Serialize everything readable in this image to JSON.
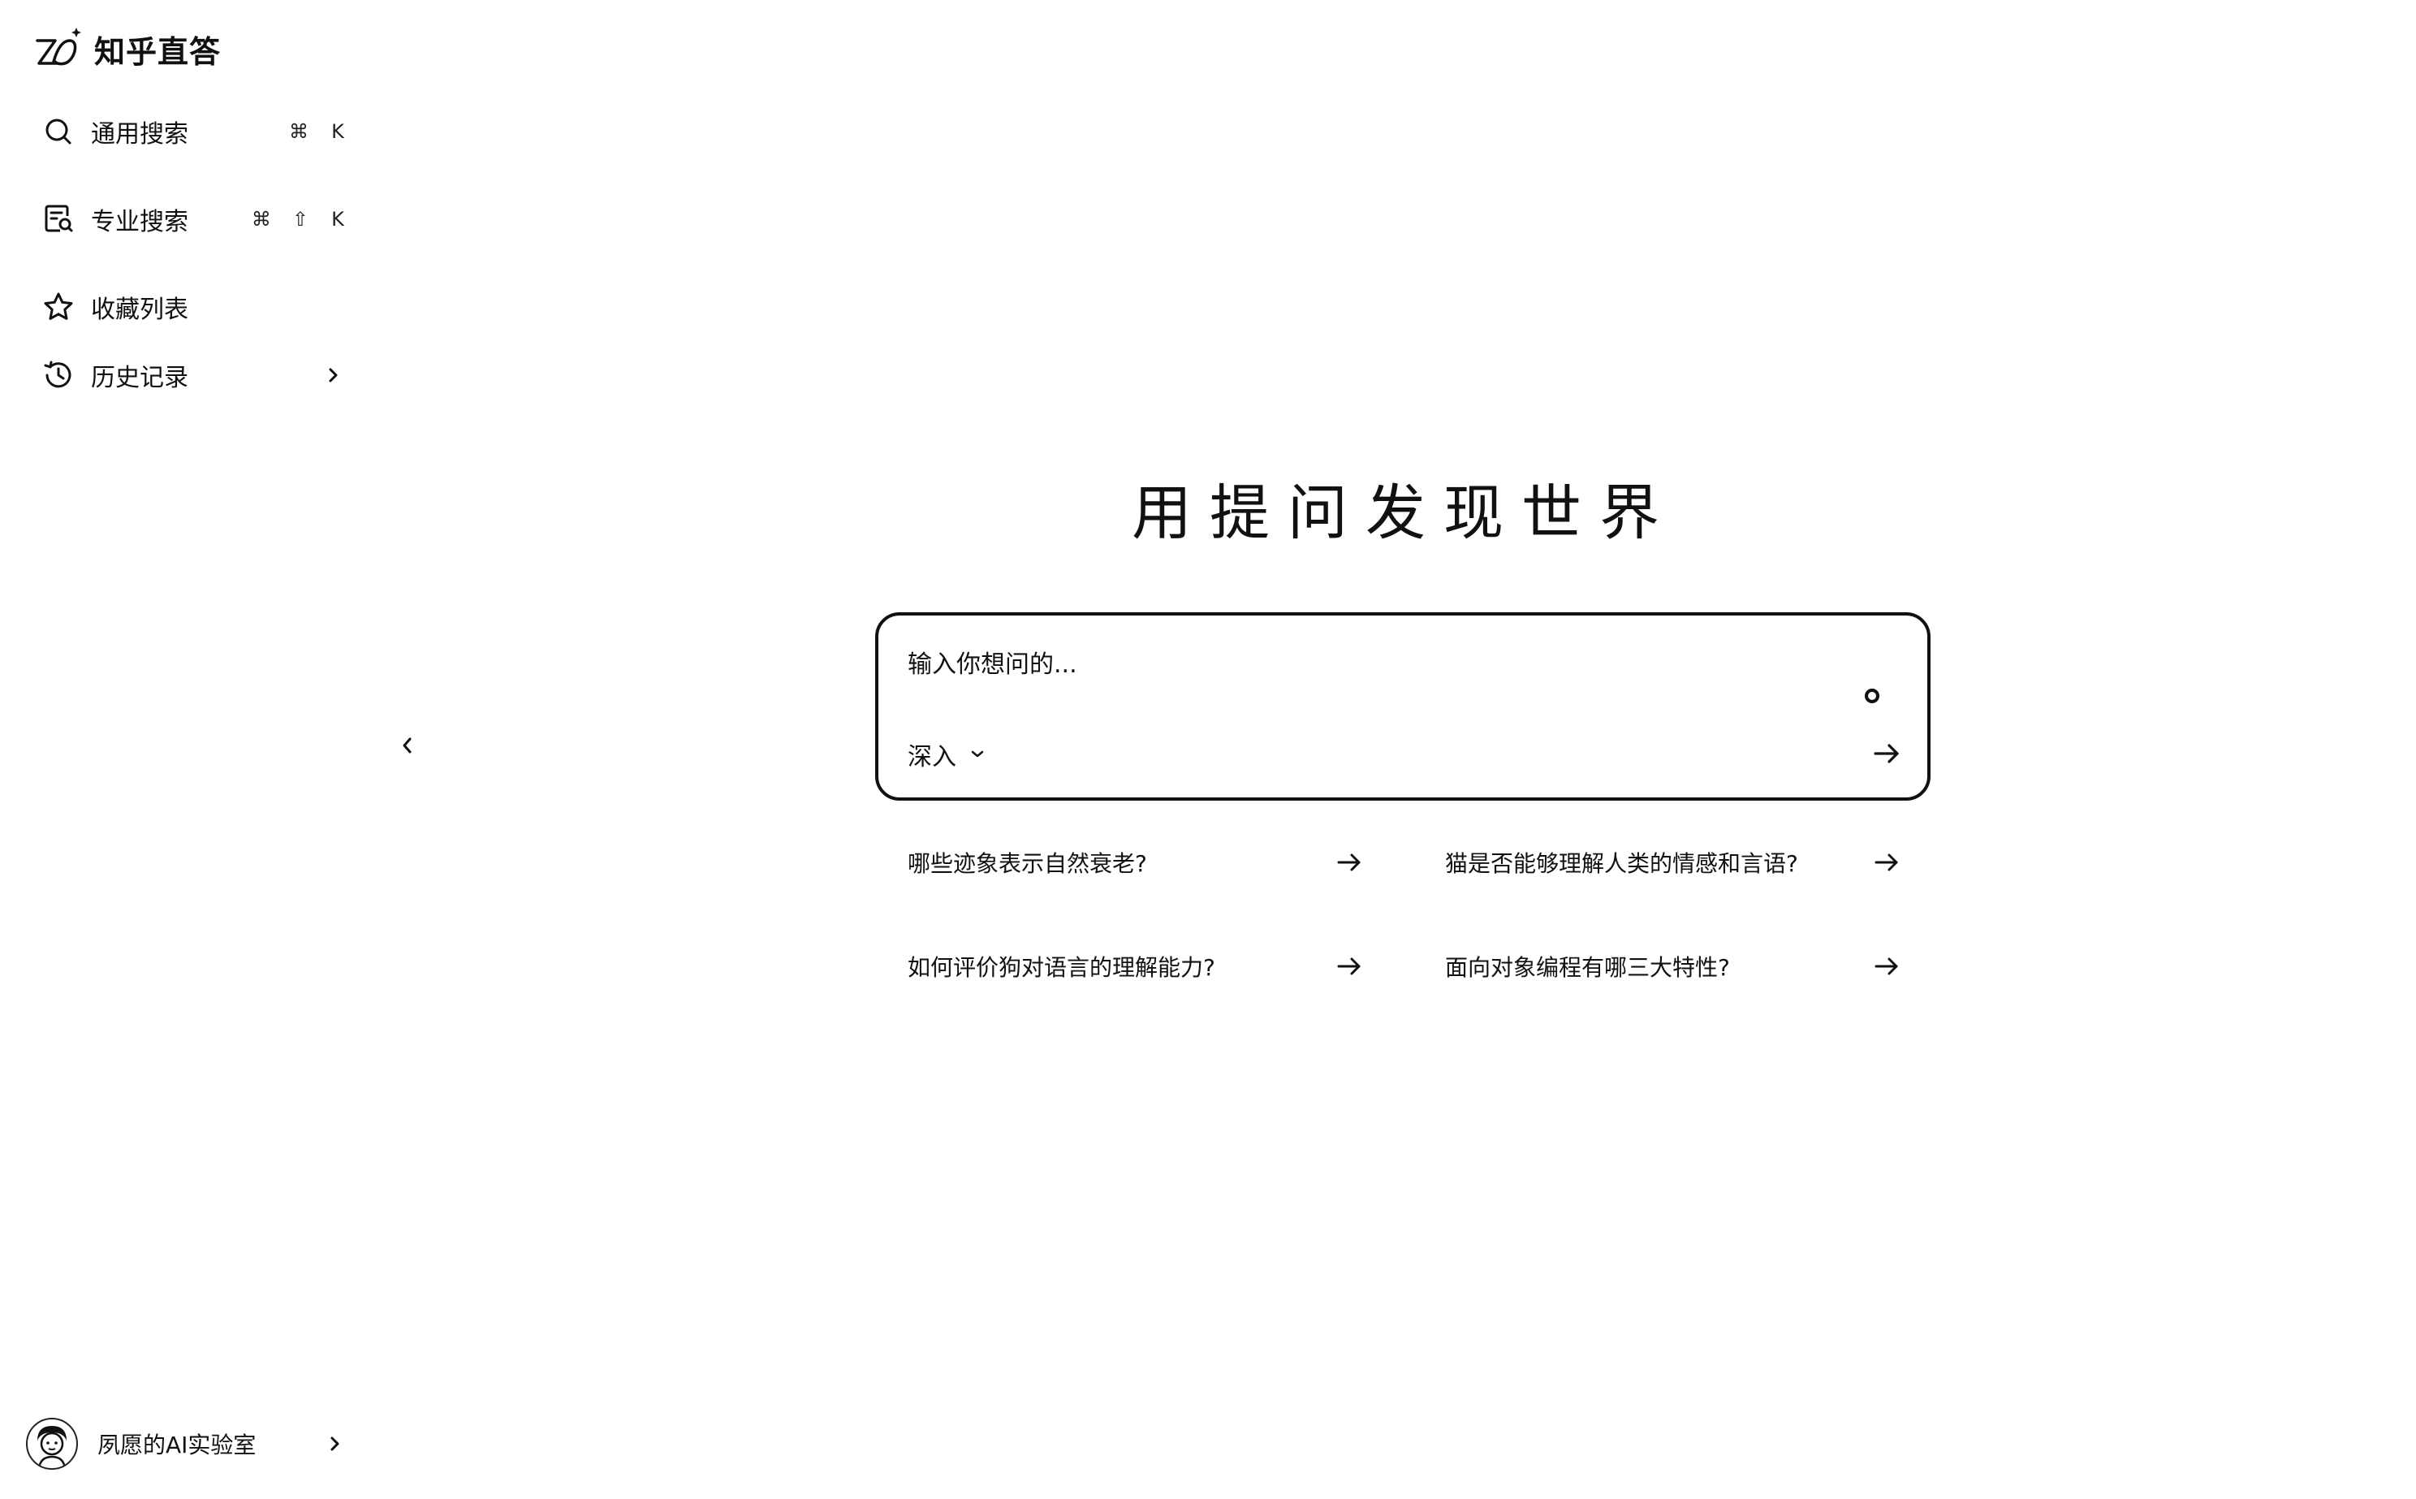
{
  "app": {
    "title": "知乎直答"
  },
  "sidebar": {
    "items": [
      {
        "label": "通用搜索",
        "icon": "search-icon",
        "shortcut": [
          "⌘",
          "K"
        ]
      },
      {
        "label": "专业搜索",
        "icon": "doc-search-icon",
        "shortcut": [
          "⌘",
          "⇧",
          "K"
        ]
      },
      {
        "label": "收藏列表",
        "icon": "star-icon"
      },
      {
        "label": "历史记录",
        "icon": "clock-icon"
      }
    ],
    "user": {
      "name": "夙愿的AI实验室"
    }
  },
  "main": {
    "headline": "用提问发现世界",
    "search": {
      "placeholder": "输入你想问的...",
      "mode_label": "深入"
    },
    "suggestions": [
      "哪些迹象表示自然衰老?",
      "猫是否能够理解人类的情感和言语?",
      "如何评价狗对语言的理解能力?",
      "面向对象编程有哪三大特性?"
    ]
  },
  "colors": {
    "text": "#111111",
    "background": "#ffffff",
    "border": "#111111"
  }
}
